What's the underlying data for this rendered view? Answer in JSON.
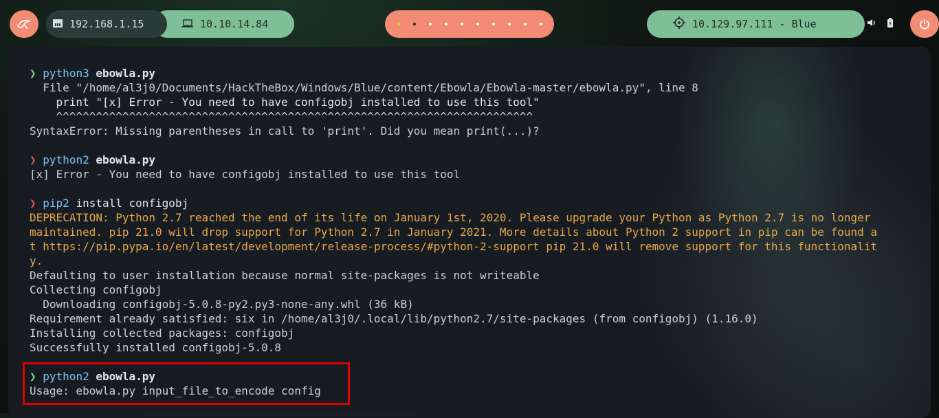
{
  "topbar": {
    "local_ip": "192.168.1.15",
    "vpn_ip": "10.10.14.84",
    "target": "10.129.97.111 - Blue",
    "workspaces": [
      "active",
      "occupied",
      "empty",
      "empty",
      "empty",
      "empty",
      "empty",
      "empty",
      "empty",
      "empty"
    ],
    "icons": {
      "os": "kali-dragon-icon",
      "local": "ethernet-icon",
      "vpn": "laptop-icon",
      "target": "crosshair-icon",
      "volume": "volume-icon",
      "battery": "battery-icon",
      "power": "power-icon"
    },
    "colors": {
      "salmon": "#f28c74",
      "mint": "#7fbf98",
      "dark": "#2a3b3a"
    }
  },
  "terminal": {
    "prompt_symbol": "❯",
    "block1": {
      "cmd": "python3",
      "arg": "ebowla.py",
      "out1": "  File \"/home/al3j0/Documents/HackTheBox/Windows/Blue/content/Ebowla/Ebowla-master/ebowla.py\", line 8",
      "out2": "    print \"[x] Error - You need to have configobj installed to use this tool\"",
      "out3": "    ^^^^^^^^^^^^^^^^^^^^^^^^^^^^^^^^^^^^^^^^^^^^^^^^^^^^^^^^^^^^^^^^^^^^^^^^",
      "out4": "SyntaxError: Missing parentheses in call to 'print'. Did you mean print(...)?"
    },
    "block2": {
      "cmd": "python2",
      "arg": "ebowla.py",
      "out1": "[x] Error - You need to have configobj installed to use this tool"
    },
    "block3": {
      "cmd": "pip2",
      "arg": " install configobj",
      "warn1": "DEPRECATION: Python 2.7 reached the end of its life on January 1st, 2020. Please upgrade your Python as Python 2.7 is no longer",
      "warn2": "maintained. pip 21.0 will drop support for Python 2.7 in January 2021. More details about Python 2 support in pip can be found a",
      "warn3": "t https://pip.pypa.io/en/latest/development/release-process/#python-2-support pip 21.0 will remove support for this functionalit",
      "warn4": "y.",
      "out1": "Defaulting to user installation because normal site-packages is not writeable",
      "out2": "Collecting configobj",
      "out3": "  Downloading configobj-5.0.8-py2.py3-none-any.whl (36 kB)",
      "out4": "Requirement already satisfied: six in /home/al3j0/.local/lib/python2.7/site-packages (from configobj) (1.16.0)",
      "out5": "Installing collected packages: configobj",
      "out6": "Successfully installed configobj-5.0.8"
    },
    "block4": {
      "cmd": "python2",
      "arg": "ebowla.py",
      "out1": "Usage: ebowla.py input_file_to_encode config"
    }
  }
}
